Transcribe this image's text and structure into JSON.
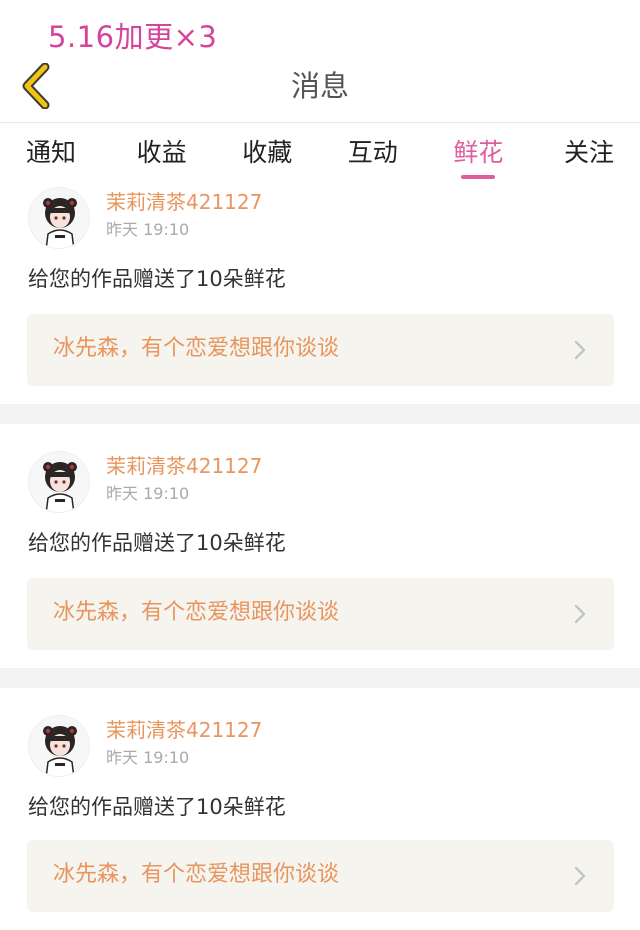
{
  "overlay_caption": "5.16加更×3",
  "header": {
    "title": "消息",
    "back_icon": "chevron-left-icon",
    "back_icon_color": "#f1c40f"
  },
  "tabs": [
    {
      "label": "通知",
      "active": false
    },
    {
      "label": "收益",
      "active": false
    },
    {
      "label": "收藏",
      "active": false
    },
    {
      "label": "互动",
      "active": false
    },
    {
      "label": "鲜花",
      "active": true
    },
    {
      "label": "关注",
      "active": false
    }
  ],
  "accent_color": "#e05d9f",
  "notifications": [
    {
      "avatar_icon": "girl-avatar-icon",
      "username": "茉莉清茶421127",
      "time": "昨天 19:10",
      "message": "给您的作品赠送了10朵鲜花",
      "quote": "冰先森，有个恋爱想跟你谈谈"
    },
    {
      "avatar_icon": "girl-avatar-icon",
      "username": "茉莉清茶421127",
      "time": "昨天 19:10",
      "message": "给您的作品赠送了10朵鲜花",
      "quote": "冰先森，有个恋爱想跟你谈谈"
    },
    {
      "avatar_icon": "girl-avatar-icon",
      "username": "茉莉清茶421127",
      "time": "昨天 19:10",
      "message": "给您的作品赠送了10朵鲜花",
      "quote": "冰先森，有个恋爱想跟你谈谈"
    }
  ]
}
